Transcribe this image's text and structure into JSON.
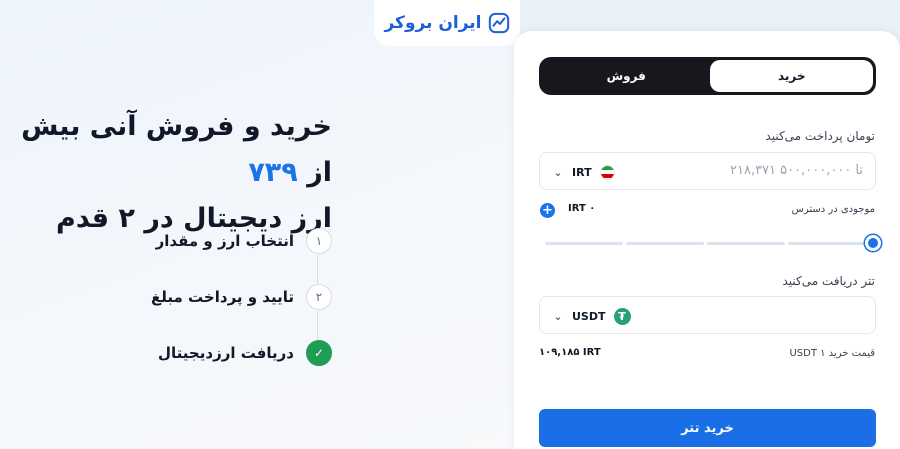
{
  "brand": {
    "name": "ایران بروکر",
    "color": "#1d5fd6"
  },
  "hero": {
    "title_line1_start": "خرید و فروش آنی بیش از",
    "title_line1_number": "۷۳۹",
    "title_line2": "ارز دیجیتال در ۲ قدم",
    "accent_color": "#1a73e8"
  },
  "steps": [
    {
      "number": "۱",
      "label": "انتخاب ارز و مقدار",
      "status": "pending"
    },
    {
      "number": "۲",
      "label": "تایید و پرداخت مبلغ",
      "status": "pending"
    },
    {
      "number": "✓",
      "label": "دریافت ارزدیجیتال",
      "status": "done",
      "color": "#1f9d55"
    }
  ],
  "trade": {
    "tabs": {
      "buy": "خرید",
      "sell": "فروش",
      "active": "buy"
    },
    "pay": {
      "label": "تومان پرداخت می‌کنید",
      "amount_placeholder": "۲۱۸,۳۷۱ تا ۵۰۰,۰۰۰,۰۰۰",
      "currency": "IRT",
      "currency_icon": "iran-flag-icon"
    },
    "balance": {
      "label": "موجودی در دسترس",
      "value": "IRT ۰",
      "add_icon": "plus-icon"
    },
    "slider": {
      "level": 1.0,
      "segments": 4
    },
    "receive": {
      "label": "تتر دریافت می‌کنید",
      "currency": "USDT",
      "currency_icon": "tether-icon"
    },
    "price": {
      "label": "قیمت خرید ۱ USDT",
      "value": "۱۰۹,۱۸۵ IRT"
    },
    "submit_label": "خرید تتر",
    "button_color": "#1a6ee6"
  }
}
